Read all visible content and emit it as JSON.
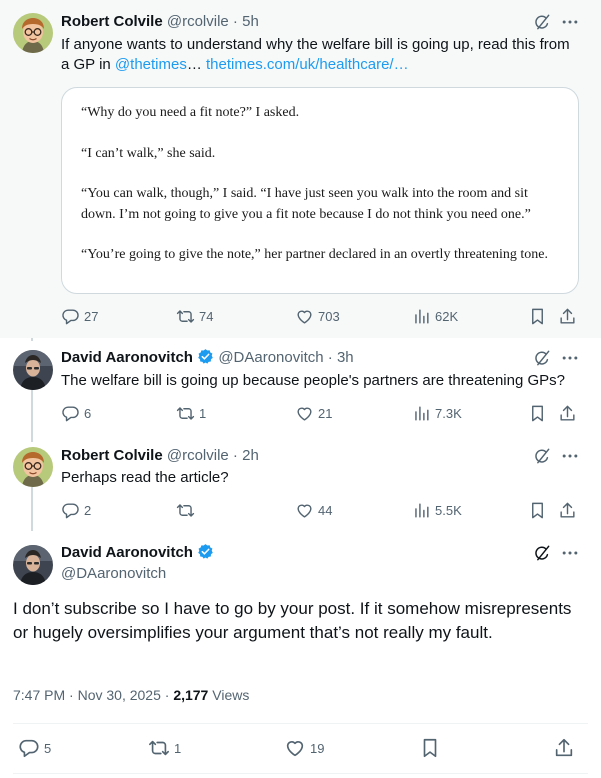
{
  "tweets": [
    {
      "name": "Robert Colvile",
      "handle": "@rcolvile",
      "time": "5h",
      "text_before": "If anyone wants to understand why the welfare bill is going up, read this from a GP in ",
      "mention": "@thetimes",
      "ellipsis": "… ",
      "url": "thetimes.com/uk/healthcare/…",
      "card": [
        "“Why do you need a fit note?” I asked.",
        "“I can’t walk,” she said.",
        "“You can walk, though,” I said. “I have just seen you walk into the room and sit down. I’m not going to give you a fit note because I do not think you need one.”",
        "“You’re going to give the note,” her partner declared in an overtly threatening tone."
      ],
      "replies": "27",
      "reposts": "74",
      "likes": "703",
      "views": "62K"
    },
    {
      "name": "David Aaronovitch",
      "handle": "@DAaronovitch",
      "time": "3h",
      "text": "The welfare bill is going up because people's partners are threatening GPs?",
      "replies": "6",
      "reposts": "1",
      "likes": "21",
      "views": "7.3K"
    },
    {
      "name": "Robert Colvile",
      "handle": "@rcolvile",
      "time": "2h",
      "text": "Perhaps read the article?",
      "replies": "2",
      "reposts": "",
      "likes": "44",
      "views": "5.5K"
    }
  ],
  "focus": {
    "name": "David Aaronovitch",
    "handle": "@DAaronovitch",
    "text": "I don’t subscribe so I have to go by your post. If it somehow misrepresents or hugely oversimplifies your argument that’s not really my fault.",
    "date": "7:47 PM · Nov 30, 2025 · ",
    "views_count": "2,177",
    "views_label": " Views",
    "replies": "5",
    "reposts": "1",
    "likes": "19"
  },
  "colors": {
    "accent": "#1d9bf0",
    "muted": "#536471",
    "verified": "#1d9bf0"
  },
  "sep": " · "
}
